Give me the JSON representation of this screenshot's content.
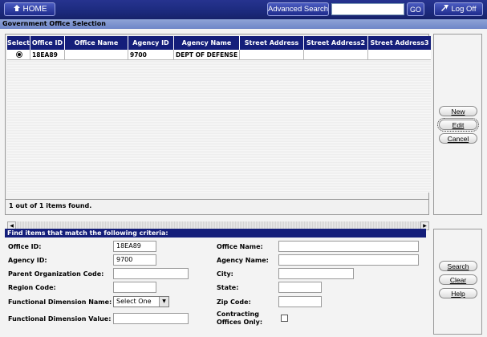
{
  "topbar": {
    "home_label": "HOME",
    "advanced_search_label": "Advanced Search",
    "search_value": "",
    "go_label": "GO",
    "logoff_label": "Log Off"
  },
  "page_title": "Government Office Selection",
  "grid": {
    "columns": [
      "Select",
      "Office ID",
      "Office Name",
      "Agency ID",
      "Agency Name",
      "Street Address",
      "Street Address2",
      "Street Address3"
    ],
    "rows": [
      {
        "selected": true,
        "office_id": "18EA89",
        "office_name": "",
        "agency_id": "9700",
        "agency_name": "DEPT OF DEFENSE",
        "street1": "",
        "street2": "",
        "street3": ""
      }
    ],
    "found_text": "1 out of 1 items found."
  },
  "actions": {
    "new_label": "New",
    "edit_label": "Edit",
    "cancel_label": "Cancel"
  },
  "criteria": {
    "title": "Find items that match the following criteria:",
    "office_id_label": "Office ID:",
    "office_id_value": "18EA89",
    "office_name_label": "Office Name:",
    "office_name_value": "",
    "agency_id_label": "Agency ID:",
    "agency_id_value": "9700",
    "agency_name_label": "Agency Name:",
    "agency_name_value": "",
    "parent_org_label": "Parent Organization Code:",
    "parent_org_value": "",
    "city_label": "City:",
    "city_value": "",
    "region_label": "Region Code:",
    "region_value": "",
    "state_label": "State:",
    "state_value": "",
    "func_dim_name_label": "Functional Dimension Name:",
    "func_dim_name_value": "Select One",
    "zip_label": "Zip Code:",
    "zip_value": "",
    "func_dim_value_label": "Functional Dimension Value:",
    "func_dim_value_value": "",
    "contracting_label_1": "Contracting",
    "contracting_label_2": "Offices Only:",
    "contracting_checked": false
  },
  "search_actions": {
    "search_label": "Search",
    "clear_label": "Clear",
    "help_label": "Help"
  },
  "colors": {
    "topbar": "#1c2a7d",
    "grid_header": "#141e7a",
    "title_bar": "#7b91cd"
  }
}
